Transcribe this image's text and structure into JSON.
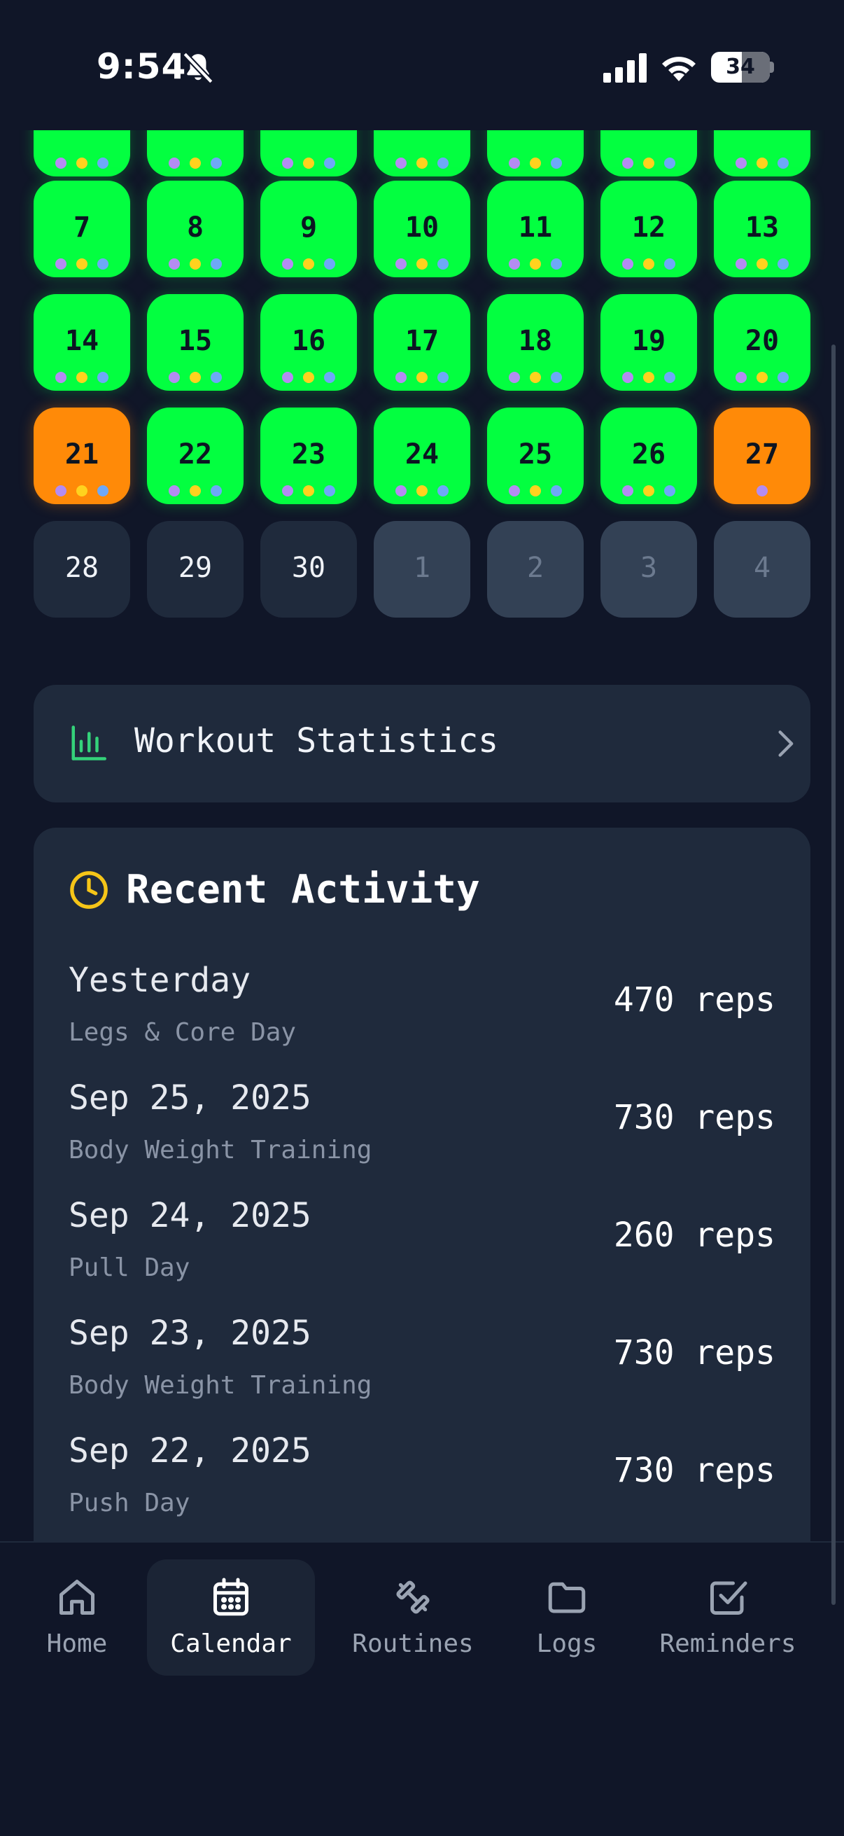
{
  "status": {
    "time": "9:54",
    "battery": "34"
  },
  "calendar": {
    "colors": {
      "completed": "#03ff40",
      "today_or_partial": "#ff8a08",
      "dot_purple": "#b48cf2",
      "dot_yellow": "#ffd21e",
      "dot_blue": "#6ea8f7"
    },
    "weeks": [
      [
        {
          "day": "",
          "state": "completed"
        },
        {
          "day": "",
          "state": "completed"
        },
        {
          "day": "",
          "state": "completed"
        },
        {
          "day": "",
          "state": "completed"
        },
        {
          "day": "",
          "state": "completed"
        },
        {
          "day": "",
          "state": "completed"
        },
        {
          "day": "",
          "state": "completed"
        }
      ],
      [
        {
          "day": "7",
          "state": "completed"
        },
        {
          "day": "8",
          "state": "completed"
        },
        {
          "day": "9",
          "state": "completed"
        },
        {
          "day": "10",
          "state": "completed"
        },
        {
          "day": "11",
          "state": "completed"
        },
        {
          "day": "12",
          "state": "completed"
        },
        {
          "day": "13",
          "state": "completed"
        }
      ],
      [
        {
          "day": "14",
          "state": "completed"
        },
        {
          "day": "15",
          "state": "completed"
        },
        {
          "day": "16",
          "state": "completed"
        },
        {
          "day": "17",
          "state": "completed"
        },
        {
          "day": "18",
          "state": "completed"
        },
        {
          "day": "19",
          "state": "completed"
        },
        {
          "day": "20",
          "state": "completed"
        }
      ],
      [
        {
          "day": "21",
          "state": "orange"
        },
        {
          "day": "22",
          "state": "completed"
        },
        {
          "day": "23",
          "state": "completed"
        },
        {
          "day": "24",
          "state": "completed"
        },
        {
          "day": "25",
          "state": "completed"
        },
        {
          "day": "26",
          "state": "completed"
        },
        {
          "day": "27",
          "state": "orange-single"
        }
      ],
      [
        {
          "day": "28",
          "state": "empty"
        },
        {
          "day": "29",
          "state": "empty"
        },
        {
          "day": "30",
          "state": "empty"
        },
        {
          "day": "1",
          "state": "other-month"
        },
        {
          "day": "2",
          "state": "other-month"
        },
        {
          "day": "3",
          "state": "other-month"
        },
        {
          "day": "4",
          "state": "other-month"
        }
      ]
    ]
  },
  "stats": {
    "label": "Workout Statistics",
    "icon": "bar-chart-icon"
  },
  "activity": {
    "title": "Recent Activity",
    "icon": "clock-icon",
    "items": [
      {
        "date": "Yesterday",
        "name": "Legs & Core Day",
        "reps": "470 reps"
      },
      {
        "date": "Sep 25, 2025",
        "name": "Body Weight Training",
        "reps": "730 reps"
      },
      {
        "date": "Sep 24, 2025",
        "name": "Pull Day",
        "reps": "260 reps"
      },
      {
        "date": "Sep 23, 2025",
        "name": "Body Weight Training",
        "reps": "730 reps"
      },
      {
        "date": "Sep 22, 2025",
        "name": "Push Day",
        "reps": "730 reps"
      }
    ]
  },
  "tabs": [
    {
      "label": "Home",
      "icon": "home-icon",
      "active": false
    },
    {
      "label": "Calendar",
      "icon": "calendar-icon",
      "active": true
    },
    {
      "label": "Routines",
      "icon": "dumbbell-icon",
      "active": false
    },
    {
      "label": "Logs",
      "icon": "folder-icon",
      "active": false
    },
    {
      "label": "Reminders",
      "icon": "checkbox-icon",
      "active": false
    }
  ]
}
